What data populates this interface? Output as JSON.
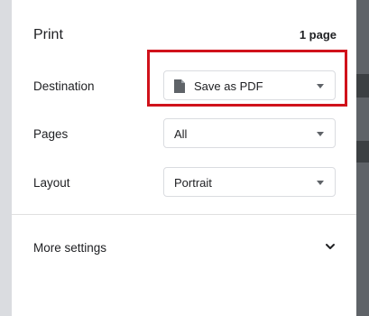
{
  "header": {
    "title": "Print",
    "page_count": "1 page"
  },
  "destination": {
    "label": "Destination",
    "value": "Save as PDF",
    "icon": "file-icon"
  },
  "pages": {
    "label": "Pages",
    "value": "All"
  },
  "layout": {
    "label": "Layout",
    "value": "Portrait"
  },
  "more_settings": {
    "label": "More settings",
    "icon": "chevron-down-icon"
  },
  "colors": {
    "highlight": "#d0121b",
    "text": "#202124",
    "border": "#dadce0"
  }
}
